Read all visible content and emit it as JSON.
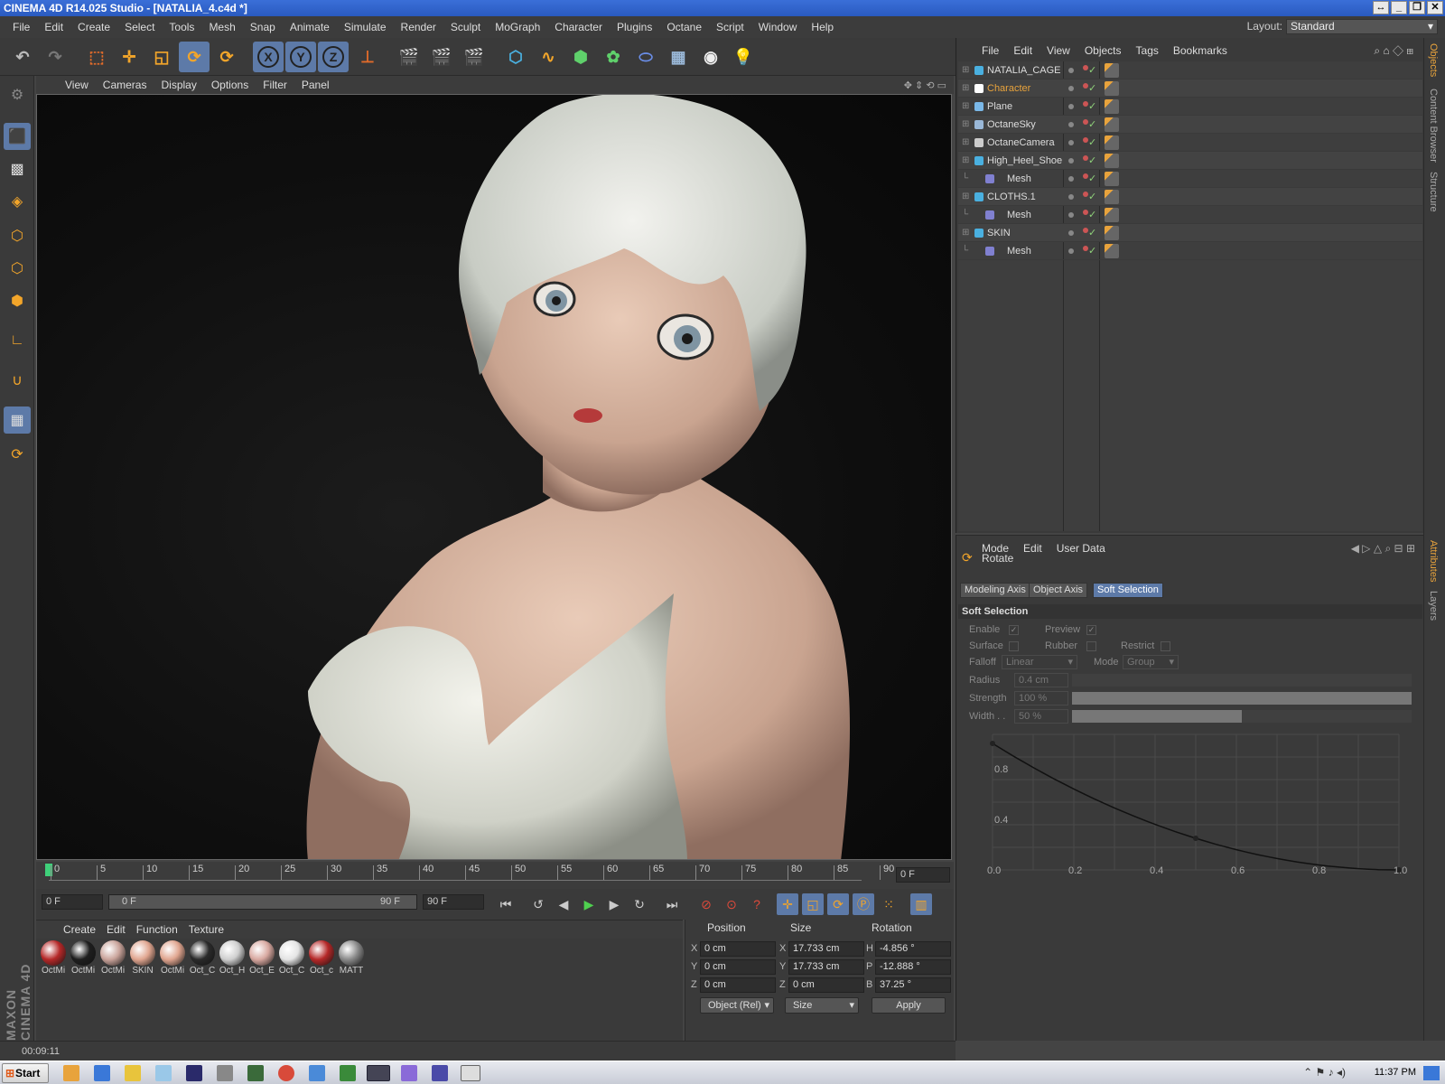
{
  "title": "CINEMA 4D R14.025 Studio - [NATALIA_4.c4d *]",
  "window_controls": [
    "↔",
    "_",
    "❐",
    "✕"
  ],
  "menu": [
    "File",
    "Edit",
    "Create",
    "Select",
    "Tools",
    "Mesh",
    "Snap",
    "Animate",
    "Simulate",
    "Render",
    "Sculpt",
    "MoGraph",
    "Character",
    "Plugins",
    "Octane",
    "Script",
    "Window",
    "Help"
  ],
  "layout": {
    "label": "Layout:",
    "value": "Standard"
  },
  "toolbar": {
    "axis_x": "X",
    "axis_y": "Y",
    "axis_z": "Z"
  },
  "viewport_menu": [
    "View",
    "Cameras",
    "Display",
    "Options",
    "Filter",
    "Panel"
  ],
  "timeline": {
    "ticks": [
      "0",
      "5",
      "10",
      "15",
      "20",
      "25",
      "30",
      "35",
      "40",
      "45",
      "50",
      "55",
      "60",
      "65",
      "70",
      "75",
      "80",
      "85",
      "90"
    ],
    "current_frame": "0 F"
  },
  "controls": {
    "start_frame": "0 F",
    "range_start": "0 F",
    "range_end": "90 F",
    "end_frame": "90 F"
  },
  "material_manager": {
    "menu": [
      "Create",
      "Edit",
      "Function",
      "Texture"
    ],
    "materials": [
      {
        "label": "OctMi",
        "color": "#b52828"
      },
      {
        "label": "OctMi",
        "color": "#1e1e1e"
      },
      {
        "label": "OctMi",
        "color": "#c9a39a"
      },
      {
        "label": "SKIN",
        "color": "#e0a58f"
      },
      {
        "label": "OctMi",
        "color": "#e0a58f"
      },
      {
        "label": "Oct_C",
        "color": "#2a2a2a"
      },
      {
        "label": "Oct_H",
        "color": "#cfcfcf"
      },
      {
        "label": "Oct_E",
        "color": "#d8a8a0"
      },
      {
        "label": "Oct_C",
        "color": "#e4e4e4"
      },
      {
        "label": "Oct_c",
        "color": "#b52828"
      },
      {
        "label": "MATT",
        "color": "#8a8a8a"
      }
    ]
  },
  "coordinates": {
    "headers": [
      "Position",
      "Size",
      "Rotation"
    ],
    "rows": [
      {
        "axis": "X",
        "pos": "0 cm",
        "size_axis": "X",
        "size": "17.733 cm",
        "rot_axis": "H",
        "rot": "-4.856 °"
      },
      {
        "axis": "Y",
        "pos": "0 cm",
        "size_axis": "Y",
        "size": "17.733 cm",
        "rot_axis": "P",
        "rot": "-12.888 °"
      },
      {
        "axis": "Z",
        "pos": "0 cm",
        "size_axis": "Z",
        "size": "0 cm",
        "rot_axis": "B",
        "rot": "37.25 °"
      }
    ],
    "mode": "Object (Rel)",
    "size_mode": "Size",
    "apply": "Apply"
  },
  "status": {
    "time": "00:09:11"
  },
  "maxon": "MAXON CINEMA 4D",
  "object_manager": {
    "menu": [
      "File",
      "Edit",
      "View",
      "Objects",
      "Tags",
      "Bookmarks"
    ],
    "objects": [
      {
        "name": "NATALIA_CAGE",
        "indent": 0,
        "color": "#dddddd",
        "icon": "#4ab0e0"
      },
      {
        "name": "Character",
        "indent": 0,
        "color": "#e8a33c",
        "icon": "#ffffff"
      },
      {
        "name": "Plane",
        "indent": 0,
        "color": "#dddddd",
        "icon": "#7ab8e8"
      },
      {
        "name": "OctaneSky",
        "indent": 0,
        "color": "#dddddd",
        "icon": "#9ab8d8"
      },
      {
        "name": "OctaneCamera",
        "indent": 0,
        "color": "#dddddd",
        "icon": "#cccccc"
      },
      {
        "name": "High_Heel_Shoe",
        "indent": 0,
        "color": "#dddddd",
        "icon": "#4ab0e0"
      },
      {
        "name": "Mesh",
        "indent": 1,
        "color": "#dddddd",
        "icon": "#8080d0"
      },
      {
        "name": "CLOTHS.1",
        "indent": 0,
        "color": "#dddddd",
        "icon": "#4ab0e0"
      },
      {
        "name": "Mesh",
        "indent": 1,
        "color": "#dddddd",
        "icon": "#8080d0"
      },
      {
        "name": "SKIN",
        "indent": 0,
        "color": "#dddddd",
        "icon": "#4ab0e0"
      },
      {
        "name": "Mesh",
        "indent": 1,
        "color": "#dddddd",
        "icon": "#8080d0"
      }
    ]
  },
  "attributes": {
    "menu": [
      "Mode",
      "Edit",
      "User Data"
    ],
    "tool_name": "Rotate",
    "tabs": [
      "Modeling Axis",
      "Object Axis",
      "Soft Selection"
    ],
    "section": "Soft Selection",
    "enable": "Enable",
    "preview": "Preview",
    "surface": "Surface",
    "rubber": "Rubber",
    "restrict": "Restrict",
    "falloff_label": "Falloff",
    "falloff_value": "Linear",
    "mode_label": "Mode",
    "mode_value": "Group",
    "radius_label": "Radius",
    "radius_value": "0.4 cm",
    "strength_label": "Strength",
    "strength_value": "100 %",
    "strength_fraction": 1.0,
    "width_label": "Width . .",
    "width_value": "50 %",
    "width_fraction": 0.5,
    "curve_y_ticks": [
      "0.8",
      "0.4"
    ],
    "curve_x_ticks": [
      "0.0",
      "0.2",
      "0.4",
      "0.6",
      "0.8",
      "1.0"
    ]
  },
  "side_tabs": [
    "Objects",
    "Content Browser",
    "Structure",
    "Attributes",
    "Layers"
  ],
  "taskbar": {
    "start": "Start",
    "clock": "11:37 PM"
  }
}
